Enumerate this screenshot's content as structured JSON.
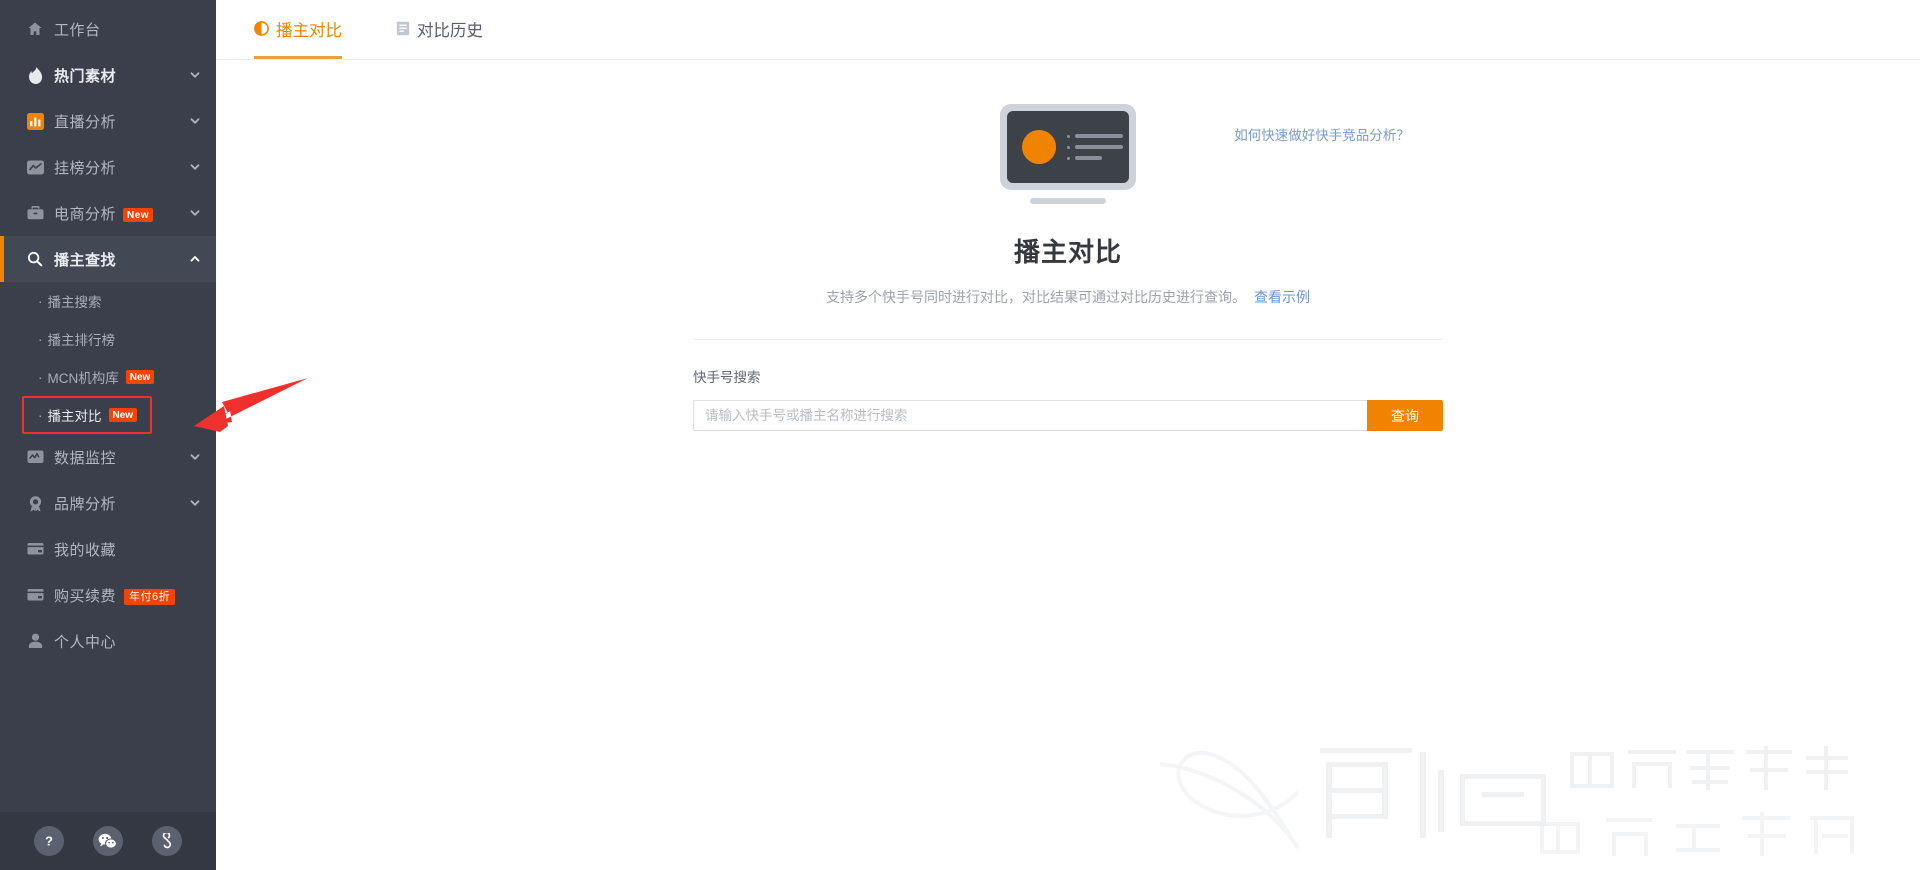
{
  "sidebar": {
    "items": [
      {
        "label": "工作台",
        "icon": "home-icon",
        "has_chevron": false,
        "type": "top",
        "active": false,
        "strong": false
      },
      {
        "label": "热门素材",
        "icon": "fire-icon",
        "has_chevron": true,
        "chevron": "down",
        "type": "top",
        "active": false,
        "strong": true
      },
      {
        "label": "直播分析",
        "icon": "bar-chart-icon",
        "has_chevron": true,
        "chevron": "down",
        "type": "top",
        "active": false,
        "strong": false
      },
      {
        "label": "挂榜分析",
        "icon": "trend-icon",
        "has_chevron": true,
        "chevron": "down",
        "type": "top",
        "active": false,
        "strong": false
      },
      {
        "label": "电商分析",
        "icon": "briefcase-icon",
        "has_chevron": true,
        "chevron": "down",
        "type": "top",
        "active": false,
        "strong": false,
        "badge": "New"
      },
      {
        "label": "播主查找",
        "icon": "search-icon",
        "has_chevron": true,
        "chevron": "up",
        "type": "top",
        "active": true,
        "strong": true
      }
    ],
    "sub_items": [
      {
        "label": "播主搜索",
        "badge": "",
        "highlight": false
      },
      {
        "label": "播主排行榜",
        "badge": "",
        "highlight": false
      },
      {
        "label": "MCN机构库",
        "badge": "New",
        "highlight": false
      },
      {
        "label": "播主对比",
        "badge": "New",
        "highlight": true
      }
    ],
    "items_after": [
      {
        "label": "数据监控",
        "icon": "monitor-icon",
        "has_chevron": true,
        "chevron": "down",
        "active": false,
        "strong": false
      },
      {
        "label": "品牌分析",
        "icon": "medal-icon",
        "has_chevron": true,
        "chevron": "down",
        "active": false,
        "strong": false
      },
      {
        "label": "我的收藏",
        "icon": "bookmark-icon",
        "has_chevron": false,
        "active": false,
        "strong": false
      },
      {
        "label": "购买续费",
        "icon": "card-icon",
        "has_chevron": false,
        "active": false,
        "strong": false,
        "sale_badge": "年付6折"
      },
      {
        "label": "个人中心",
        "icon": "user-icon",
        "has_chevron": false,
        "active": false,
        "strong": false
      }
    ],
    "bottom_buttons": [
      {
        "name": "help-icon",
        "glyph": "?"
      },
      {
        "name": "wechat-icon",
        "glyph": ""
      },
      {
        "name": "link-icon",
        "glyph": ""
      }
    ],
    "colors": {
      "background": "#3a3f4b",
      "active_background": "#434855",
      "accent": "#f08300",
      "badge": "#f24405",
      "highlight_outline": "#f0302c"
    }
  },
  "tabs": [
    {
      "label": "播主对比",
      "icon": "contrast-icon",
      "active": true
    },
    {
      "label": "对比历史",
      "icon": "document-icon",
      "active": false
    }
  ],
  "content": {
    "help_link": "如何快速做好快手竞品分析？",
    "title": "播主对比",
    "subtitle": "支持多个快手号同时进行对比，对比结果可通过对比历史进行查询。",
    "example_link": "查看示例"
  },
  "search": {
    "label": "快手号搜索",
    "placeholder": "请输入快手号或播主名称进行搜索",
    "value": "",
    "button": "查询"
  },
  "watermark": {
    "brand": "店小白",
    "line1": "电商卖家助手",
    "line2": "电商运营官"
  },
  "annotation": {
    "type": "red-arrow",
    "color": "#f0302c"
  }
}
